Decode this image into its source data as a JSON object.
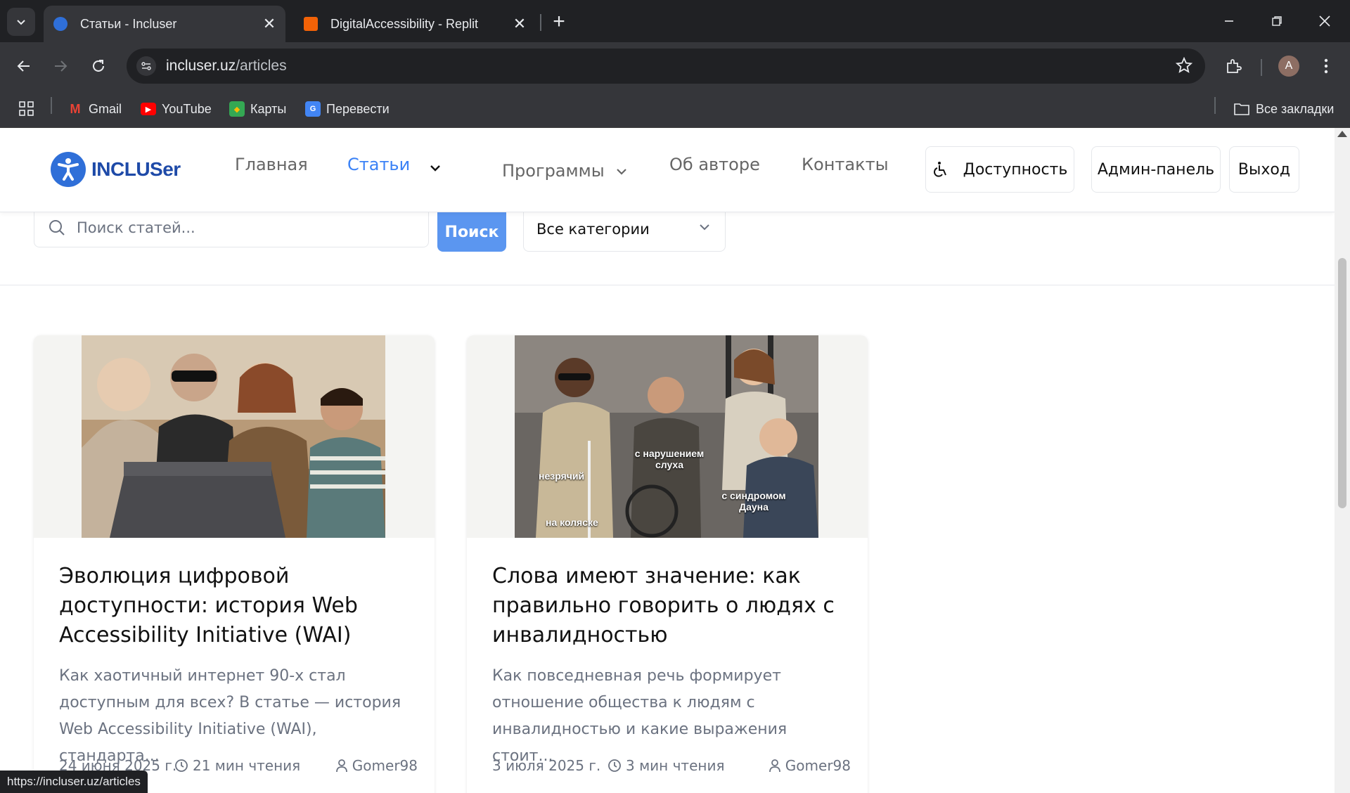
{
  "browser": {
    "tabs": [
      {
        "title": "Статьи - Incluser",
        "active": true
      },
      {
        "title": "DigitalAccessibility - Replit",
        "active": false
      }
    ],
    "url_host": "incluser.uz",
    "url_path": "/articles",
    "profile_initial": "A",
    "bookmarks": [
      "Gmail",
      "YouTube",
      "Карты",
      "Перевести"
    ],
    "all_bookmarks": "Все закладки",
    "status_url": "https://incluser.uz/articles"
  },
  "site": {
    "logo_text": "INCLUSer",
    "nav": {
      "home": "Главная",
      "articles": "Статьи",
      "programs": "Программы",
      "about": "Об авторе",
      "contacts": "Контакты"
    },
    "buttons": {
      "accessibility": "Доступность",
      "admin": "Админ-панель",
      "logout": "Выход"
    },
    "accent_color": "#3b82f6"
  },
  "search": {
    "placeholder": "Поиск статей...",
    "button": "Поиск",
    "category": "Все категории"
  },
  "articles": [
    {
      "title": "Эволюция цифровой доступности: история Web Accessibility Initiative (WAI)",
      "excerpt": "Как хаотичный интернет 90-х стал доступным для всех? В статье — история Web Accessibility Initiative (WAI), стандарта...",
      "date": "24 июня 2025 г.",
      "read_time": "21 мин чтения",
      "author": "Gomer98"
    },
    {
      "title": "Слова имеют значение: как правильно говорить о людях с инвалидностью",
      "excerpt": "Как повседневная речь формирует отношение общества к людям с инвалидностью и какие выражения стоит...",
      "date": "3 июля 2025 г.",
      "read_time": "3 мин чтения",
      "author": "Gomer98",
      "image_labels": {
        "blind": "незрячий",
        "deaf": "с нарушением слуха",
        "wheelchair": "на коляске",
        "down": "с синдромом Дауна"
      }
    }
  ]
}
